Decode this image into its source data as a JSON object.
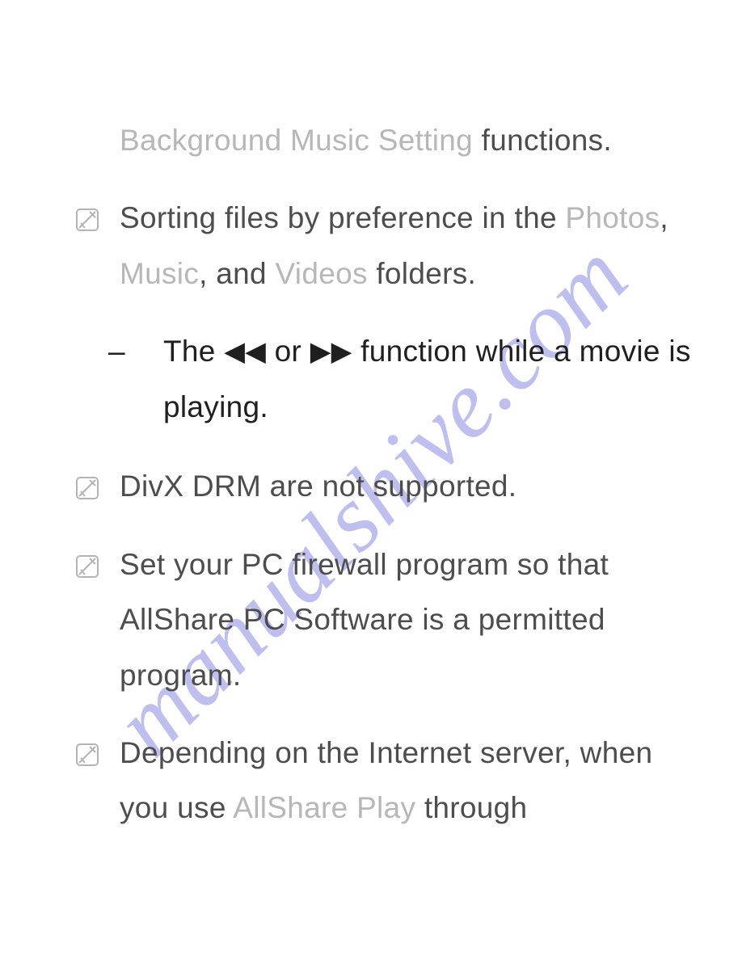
{
  "watermark": "manualshive.com",
  "p0": {
    "label": "Background Music Setting",
    "tail": " functions."
  },
  "p1": {
    "lead": "Sorting files by preference in the ",
    "photos": "Photos",
    "sep1": ", ",
    "music": "Music",
    "sep2": ", and ",
    "videos": "Videos",
    "tail": " folders."
  },
  "sub": {
    "dash": "– ",
    "before": "The ",
    "rew": "◀◀",
    "mid": " or ",
    "ffw": "▶▶",
    "after": " function while a movie is playing."
  },
  "p2": "DivX DRM are not supported.",
  "p3": "Set your PC firewall program so that AllShare PC Software is a permitted program.",
  "p4": {
    "lead": "Depending on the Internet server, when you use ",
    "label": "AllShare Play",
    "tail": " through"
  },
  "icon_note": "note-icon"
}
